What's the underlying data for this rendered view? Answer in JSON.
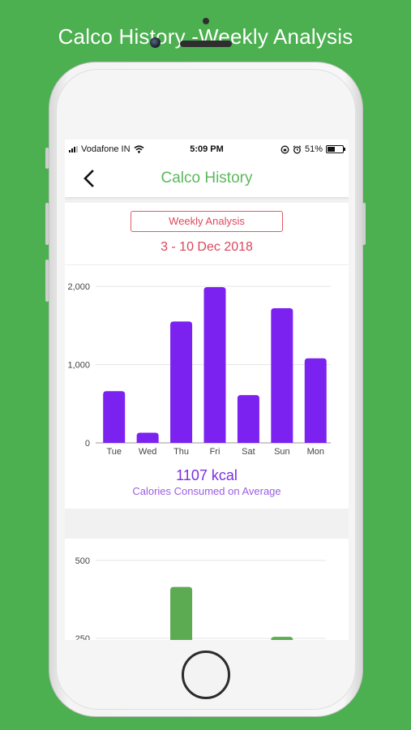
{
  "promo": {
    "title": "Calco History -Weekly Analysis"
  },
  "status_bar": {
    "carrier": "Vodafone IN",
    "time": "5:09 PM",
    "battery": "51%",
    "battery_level": 0.51
  },
  "nav": {
    "title": "Calco History",
    "back_icon": "chevron-left-icon"
  },
  "analysis": {
    "button_label": "Weekly Analysis",
    "date_range": "3 - 10 Dec 2018",
    "average_value": "1107 kcal",
    "average_caption": "Calories Consumed on Average"
  },
  "colors": {
    "background": "#4caf50",
    "bar_primary": "#7b22f0",
    "bar_secondary": "#5cab53",
    "title_green": "#5cb85c",
    "accent_red": "#e0485a"
  },
  "chart_data": [
    {
      "type": "bar",
      "categories": [
        "Tue",
        "Wed",
        "Thu",
        "Fri",
        "Sat",
        "Sun",
        "Mon"
      ],
      "values": [
        660,
        130,
        1550,
        1990,
        610,
        1720,
        1080
      ],
      "ylim": [
        0,
        2000
      ],
      "yticks": [
        0,
        1000,
        2000
      ],
      "ytick_labels": [
        "0",
        "1,000",
        "2,000"
      ],
      "grid": true
    },
    {
      "type": "bar",
      "partially_visible": true,
      "yticks": [
        250,
        500
      ],
      "ytick_labels": [
        "250",
        "500"
      ],
      "visible_bar_tops": [
        {
          "category_index": 2,
          "value": 415
        },
        {
          "category_index": 5,
          "value": 255
        }
      ],
      "grid": true
    }
  ]
}
